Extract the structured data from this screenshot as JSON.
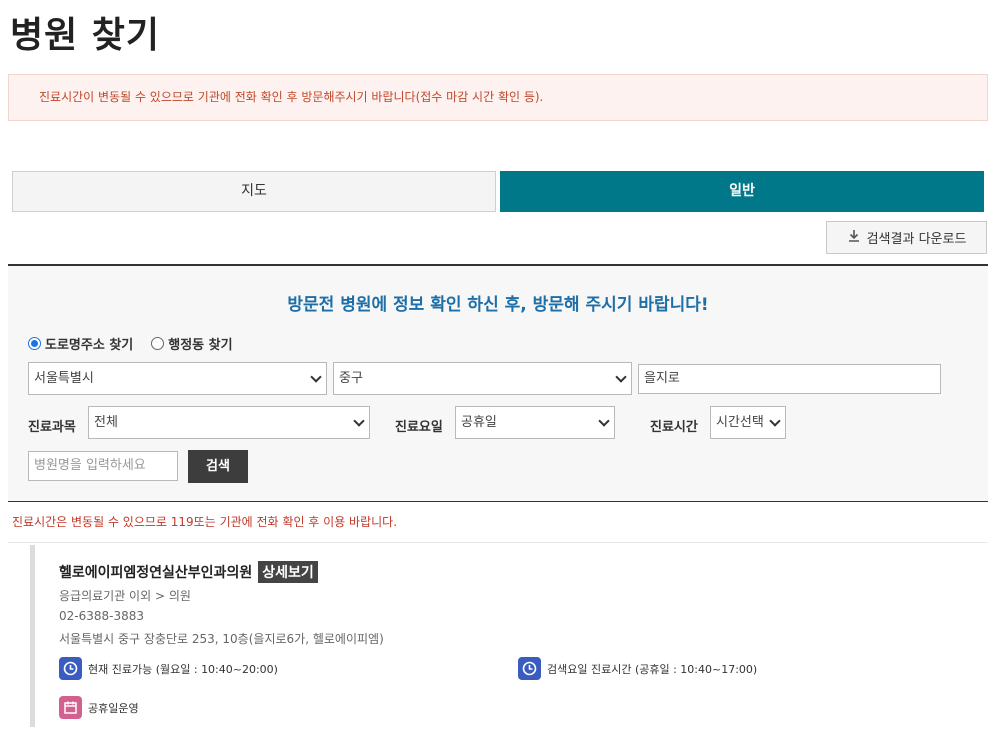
{
  "page": {
    "title": "병원 찾기",
    "notice": "진료시간이 변동될 수 있으므로 기관에 전화 확인 후 방문해주시기 바랍니다(접수 마감 시간 확인 등)."
  },
  "tabs": [
    {
      "label": "지도",
      "active": false
    },
    {
      "label": "일반",
      "active": true
    }
  ],
  "toolbar": {
    "download_label": "검색결과 다운로드"
  },
  "search": {
    "heading": "방문전 병원에 정보 확인 하신 후, 방문해 주시기 바랍니다!",
    "radio_road": "도로명주소 찾기",
    "radio_admin": "행정동 찾기",
    "selected_radio": "road",
    "city": "서울특별시",
    "district": "중구",
    "street_value": "을지로",
    "dept_label": "진료과목",
    "dept_value": "전체",
    "day_label": "진료요일",
    "day_value": "공휴일",
    "time_label": "진료시간",
    "time_value": "시간선택",
    "name_placeholder": "병원명을 입력하세요",
    "search_button": "검색"
  },
  "warning": "진료시간은 변동될 수 있으므로 119또는 기관에 전화 확인 후 이용 바랍니다.",
  "results": [
    {
      "name": "헬로에이피엠정연실산부인과의원",
      "detail_label": "상세보기",
      "category": "응급의료기관 이외 > 의원",
      "phone": "02-6388-3883",
      "address": "서울특별시 중구 장충단로 253, 10층(을지로6가, 헬로에이피엠)",
      "status_now": "현재 진료가능 (월요일 : 10:40~20:00)",
      "status_search": "검색요일 진료시간 (공휴일 : 10:40~17:00)",
      "holiday": "공휴일운영"
    }
  ],
  "colors": {
    "accent": "#00788a",
    "heading_blue": "#1e6fa8",
    "warning_red": "#c0392b"
  },
  "icons": {
    "download": "download-icon",
    "clock": "clock-icon",
    "calendar": "calendar-icon"
  }
}
